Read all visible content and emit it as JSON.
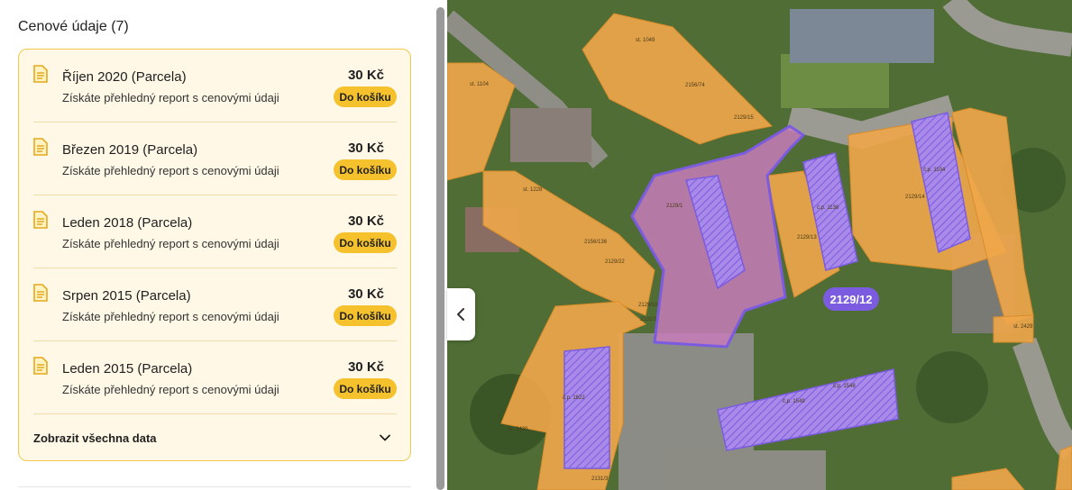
{
  "prices_section": {
    "title": "Cenové údaje (7)",
    "items": [
      {
        "title": "Říjen 2020 (Parcela)",
        "subtitle": "Získáte přehledný report s cenovými údaji",
        "price": "30 Kč",
        "button": "Do košíku"
      },
      {
        "title": "Březen 2019 (Parcela)",
        "subtitle": "Získáte přehledný report s cenovými údaji",
        "price": "30 Kč",
        "button": "Do košíku"
      },
      {
        "title": "Leden 2018 (Parcela)",
        "subtitle": "Získáte přehledný report s cenovými údaji",
        "price": "30 Kč",
        "button": "Do košíku"
      },
      {
        "title": "Srpen 2015 (Parcela)",
        "subtitle": "Získáte přehledný report s cenovými údaji",
        "price": "30 Kč",
        "button": "Do košíku"
      },
      {
        "title": "Leden 2015 (Parcela)",
        "subtitle": "Získáte přehledný report s cenovými údaji",
        "price": "30 Kč",
        "button": "Do košíku"
      }
    ],
    "show_all": "Zobrazit všechna data"
  },
  "map": {
    "selected_parcel": "2129/12",
    "labels": [
      "st. 1049",
      "2156/74",
      "2129/15",
      "st. 1104",
      "st. 1228",
      "2129/1",
      "2129/13",
      "2129/14",
      "2156/136",
      "2129/22",
      "2129/10",
      "2131/1",
      "st. 2429",
      "st. 2420",
      "2131/3",
      "č.p. 1549",
      "č.p. 1548",
      "č.p. 1136",
      "č.p. 1104",
      "č.p. 1622"
    ]
  },
  "colors": {
    "accent": "#f5c22e",
    "card_bg": "#fff8e6",
    "card_border": "#f2c94c",
    "parcel_orange": "#f0a64a",
    "parcel_purple": "#7b5ce0"
  }
}
